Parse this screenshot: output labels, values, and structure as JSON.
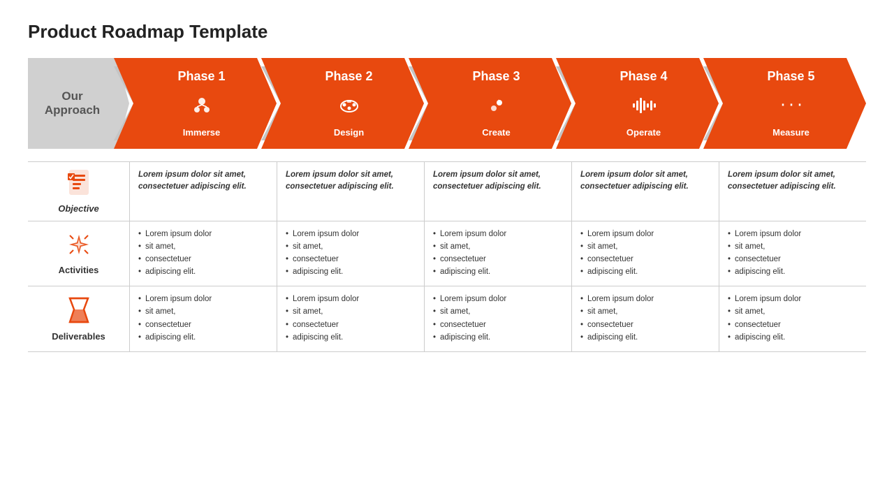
{
  "title": "Product Roadmap Template",
  "approach": "Our\nApproach",
  "phases": [
    {
      "id": "phase1",
      "label": "Phase 1",
      "icon": "cluster",
      "name": "Immerse"
    },
    {
      "id": "phase2",
      "label": "Phase 2",
      "icon": "palette",
      "name": "Design"
    },
    {
      "id": "phase3",
      "label": "Phase 3",
      "icon": "gears",
      "name": "Create"
    },
    {
      "id": "phase4",
      "label": "Phase 4",
      "icon": "soundwave",
      "name": "Operate"
    },
    {
      "id": "phase5",
      "label": "Phase 5",
      "icon": "arrows",
      "name": "Measure"
    }
  ],
  "rows": [
    {
      "id": "objective",
      "label": "Objective",
      "icon_type": "checklist",
      "italic": true,
      "cells": [
        "Lorem ipsum dolor sit amet, consectetuer adipiscing elit.",
        "Lorem ipsum dolor sit amet, consectetuer adipiscing elit.",
        "Lorem ipsum dolor sit amet, consectetuer adipiscing elit.",
        "Lorem ipsum dolor sit amet, consectetuer adipiscing elit.",
        "Lorem ipsum dolor sit amet, consectetuer adipiscing elit."
      ]
    },
    {
      "id": "activities",
      "label": "Activities",
      "icon_type": "sparkle",
      "italic": false,
      "cells": [
        [
          "Lorem ipsum dolor",
          "sit amet,",
          "consectetuer",
          "adipiscing elit."
        ],
        [
          "Lorem ipsum dolor",
          "sit amet,",
          "consectetuer",
          "adipiscing elit."
        ],
        [
          "Lorem ipsum dolor",
          "sit amet,",
          "consectetuer",
          "adipiscing elit."
        ],
        [
          "Lorem ipsum dolor",
          "sit amet,",
          "consectetuer",
          "adipiscing elit."
        ],
        [
          "Lorem ipsum dolor",
          "sit amet,",
          "consectetuer",
          "adipiscing elit."
        ]
      ]
    },
    {
      "id": "deliverables",
      "label": "Deliverables",
      "icon_type": "hourglass",
      "italic": false,
      "cells": [
        [
          "Lorem ipsum dolor",
          "sit amet,",
          "consectetuer",
          "adipiscing elit."
        ],
        [
          "Lorem ipsum dolor",
          "sit amet,",
          "consectetuer",
          "adipiscing elit."
        ],
        [
          "Lorem ipsum dolor",
          "sit amet,",
          "consectetuer",
          "adipiscing elit."
        ],
        [
          "Lorem ipsum dolor",
          "sit amet,",
          "consectetuer",
          "adipiscing elit."
        ],
        [
          "Lorem ipsum dolor",
          "sit amet,",
          "consectetuer",
          "adipiscing elit."
        ]
      ]
    }
  ],
  "colors": {
    "orange": "#e8490f",
    "gray": "#c5c5c5",
    "white": "#ffffff"
  }
}
